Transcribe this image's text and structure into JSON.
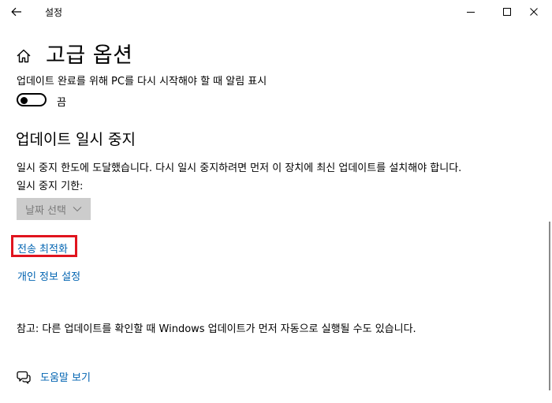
{
  "window": {
    "title": "설정",
    "back_icon": "back-arrow-icon",
    "controls": [
      "minimize-icon",
      "maximize-icon",
      "close-icon"
    ]
  },
  "header": {
    "icon": "home-icon",
    "title": "고급 옵션"
  },
  "notify": {
    "label": "업데이트 완료를 위해 PC를 다시 시작해야 할 때 알림 표시",
    "toggle_state": "끔",
    "toggle_on": false
  },
  "pause": {
    "title": "업데이트 일시 중지",
    "info": "일시 중지 한도에 도달했습니다. 다시 일시 중지하려면 먼저 이 장치에 최신 업데이트를 설치해야 합니다.",
    "date_label": "일시 중지 기한:",
    "date_select": "날짜 선택"
  },
  "links": {
    "delivery": "전송 최적화",
    "privacy": "개인 정보 설정"
  },
  "note": "참고: 다른 업데이트를 확인할 때 Windows 업데이트가 먼저 자동으로 실행될 수도 있습니다.",
  "help": {
    "icon": "help-chat-icon",
    "label": "도움말 보기"
  },
  "colors": {
    "link": "#0063b1",
    "highlight": "#e0141e",
    "disabled_bg": "#cccccc"
  }
}
